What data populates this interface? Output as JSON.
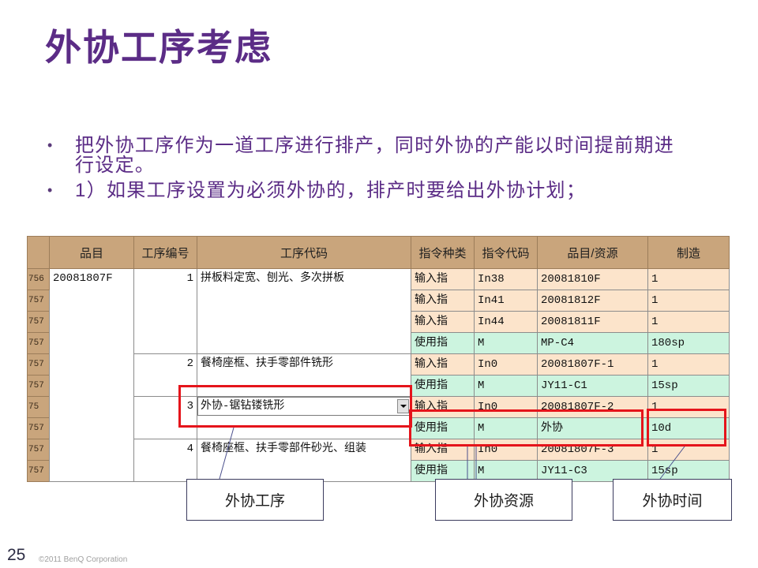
{
  "slide": {
    "title": "外协工序考虑",
    "bullet": "•",
    "bullets": [
      "把外协工序作为一道工序进行排产，同时外协的产能以时间提前期进行设定。",
      "1）如果工序设置为必须外协的，排产时要给出外协计划；"
    ],
    "page_number": "25",
    "copyright": "©2011 BenQ Corporation"
  },
  "grid": {
    "headers": {
      "item": "品目",
      "op_no": "工序编号",
      "op_code": "工序代码",
      "instr_type": "指令种类",
      "instr_code": "指令代码",
      "item_resource": "品目/资源",
      "make": "制造"
    },
    "item": "20081807F",
    "operations": [
      {
        "op_no": "1",
        "op_code": "拼板料定宽、刨光、多次拼板"
      },
      {
        "op_no": "2",
        "op_code": "餐椅座框、扶手零部件铣形"
      },
      {
        "op_no": "3",
        "op_code": "外协-锯钻镂铣形"
      },
      {
        "op_no": "4",
        "op_code": "餐椅座框、扶手零部件砂光、组装"
      }
    ],
    "rows": [
      {
        "row_no": "756",
        "instr_type": "输入指",
        "instr_code": "In38",
        "item_resource": "20081810F",
        "make": "1"
      },
      {
        "row_no": "757",
        "instr_type": "输入指",
        "instr_code": "In41",
        "item_resource": "20081812F",
        "make": "1"
      },
      {
        "row_no": "757",
        "instr_type": "输入指",
        "instr_code": "In44",
        "item_resource": "20081811F",
        "make": "1"
      },
      {
        "row_no": "757",
        "instr_type": "使用指",
        "instr_code": "M",
        "item_resource": "MP-C4",
        "make": "180sp"
      },
      {
        "row_no": "757",
        "instr_type": "输入指",
        "instr_code": "In0",
        "item_resource": "20081807F-1",
        "make": "1"
      },
      {
        "row_no": "757",
        "instr_type": "使用指",
        "instr_code": "M",
        "item_resource": "JY11-C1",
        "make": "15sp"
      },
      {
        "row_no": "75",
        "instr_type": "输入指",
        "instr_code": "In0",
        "item_resource": "20081807F-2",
        "make": "1"
      },
      {
        "row_no": "757",
        "instr_type": "使用指",
        "instr_code": "M",
        "item_resource": "外协",
        "make": "10d"
      },
      {
        "row_no": "757",
        "instr_type": "输入指",
        "instr_code": "In0",
        "item_resource": "20081807F-3",
        "make": "1"
      },
      {
        "row_no": "757",
        "instr_type": "使用指",
        "instr_code": "M",
        "item_resource": "JY11-C3",
        "make": "15sp"
      }
    ]
  },
  "callouts": [
    "外协工序",
    "外协资源",
    "外协时间"
  ],
  "icons": {
    "combo_arrow": "chevron-down-icon",
    "bullet": "bullet-icon"
  },
  "colors": {
    "title_purple": "#5B2C86",
    "highlight_red": "#E5141B",
    "header_tan": "#C9A57C",
    "input_row": "#FCE4CB",
    "use_row": "#CCF4DF"
  }
}
